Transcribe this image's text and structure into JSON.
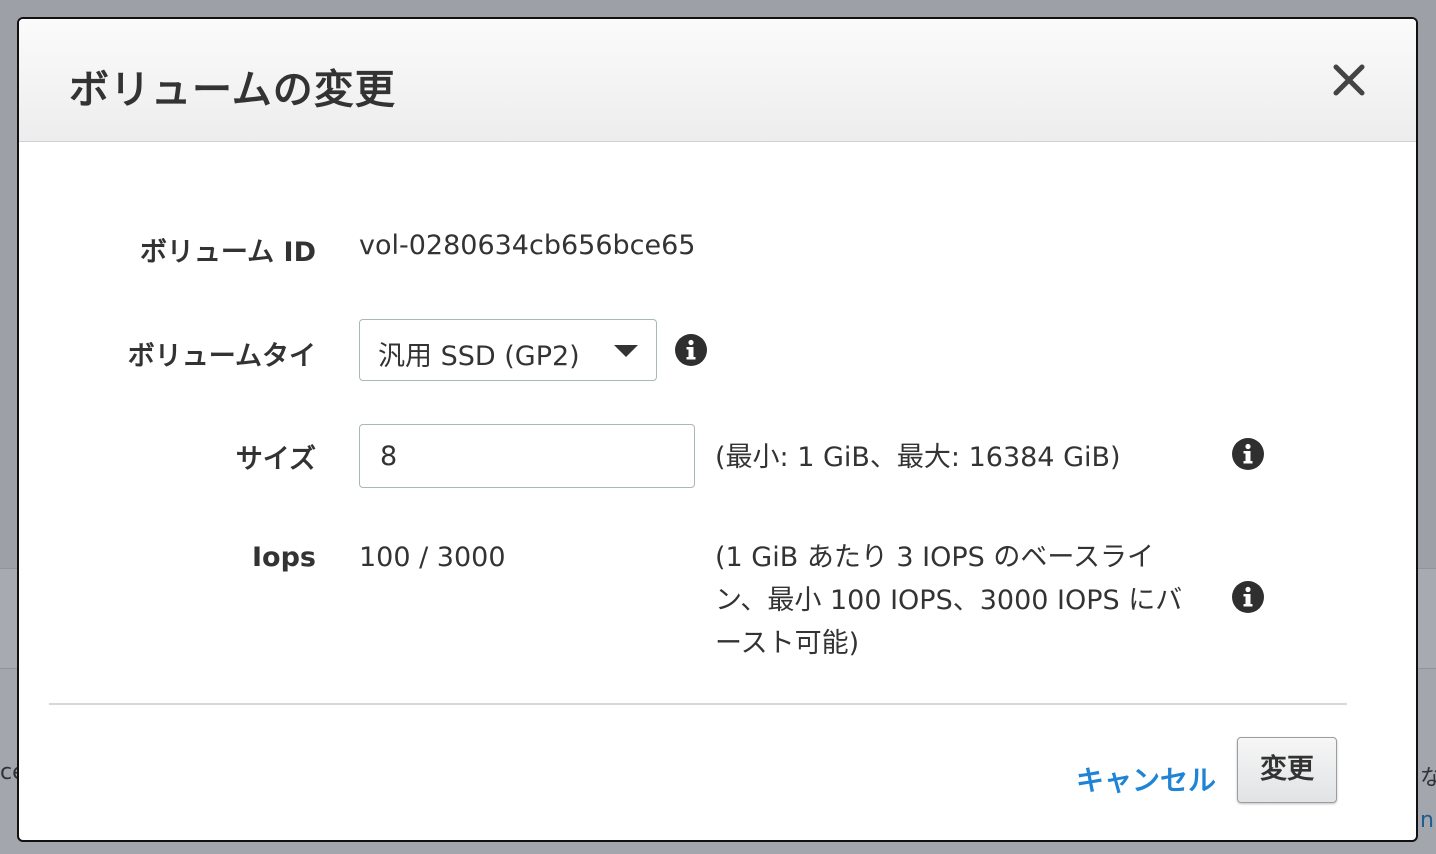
{
  "background": {
    "left_fragment": "ce",
    "right_fragment_1": "な",
    "right_fragment_2": "n"
  },
  "modal": {
    "title": "ボリュームの変更",
    "close_icon": "close-icon",
    "fields": {
      "volume_id": {
        "label": "ボリューム ID",
        "value": "vol-0280634cb656bce65"
      },
      "volume_type": {
        "label": "ボリュームタイ",
        "selected": "汎用 SSD (GP2)",
        "icon": "info-icon"
      },
      "size": {
        "label": "サイズ",
        "value": "8",
        "help": "(最小: 1 GiB、最大: 16384 GiB)",
        "icon": "info-icon"
      },
      "iops": {
        "label": "Iops",
        "value": "100 / 3000",
        "help_line_1": "(1 GiB あたり 3 IOPS のベースライ",
        "help_line_2": "ン、最小 100 IOPS、3000 IOPS にバ",
        "help_line_3": "ースト可能)",
        "icon": "info-icon"
      }
    },
    "footer": {
      "cancel_label": "キャンセル",
      "submit_label": "変更"
    }
  },
  "colors": {
    "link": "#1f84d6",
    "backdrop": "#9da1a7",
    "text": "#333333"
  }
}
